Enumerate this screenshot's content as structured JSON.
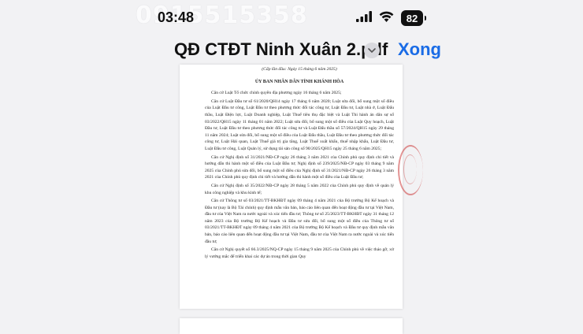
{
  "status_bar": {
    "time": "03:48",
    "battery": "82",
    "watermark": "0915515358"
  },
  "header": {
    "title": "QĐ CTĐT Ninh Xuân 2.pdf",
    "done_label": "Xong"
  },
  "document": {
    "issue_line": "(Cấp lần đầu: Ngày 15 tháng 6 năm 2025)",
    "authority": "ỦY BAN NHÂN DÂN TỈNH KHÁNH HÒA",
    "paragraphs": [
      "Căn cứ Luật Tổ chức chính quyền địa phương ngày 16 tháng 6 năm 2025;",
      "Căn cứ Luật Đầu tư số 61/2020/QH14 ngày 17 tháng 6 năm 2020; Luật sửa đổi, bổ sung một số điều của Luật Đầu tư công, Luật Đầu tư theo phương thức đối tác công tư, Luật Đầu tư, Luật nhà ở, Luật Đấu thầu, Luật Điện lực, Luật Doanh nghiệp, Luật Thuế tiêu thụ đặc biệt và Luật Thi hành án dân sự số 03/2022/QH15 ngày 11 tháng 01 năm 2022; Luật sửa đổi, bổ sung một số điều của Luật Quy hoạch, Luật Đầu tư, Luật Đầu tư theo phương thức đối tác công tư và Luật Đấu thầu số 57/2024/QH15 ngày 29 tháng 11 năm 2024; Luật sửa đổi, bổ sung một số điều của Luật Đấu thầu, Luật Đầu tư theo phương thức đối tác công tư, Luật Hải quan, Luật Thuế giá trị gia tăng, Luật Thuế xuất khẩu, thuế nhập khẩu, Luật Đầu tư, Luật Đầu tư công, Luật Quản lý, sử dụng tài sản công số 90/2025/QH15 ngày 25 tháng 6 năm 2025;",
      "Căn cứ Nghị định số 31/2021/NĐ-CP ngày 26 tháng 3 năm 2021 của Chính phủ quy định chi tiết và hướng dẫn thi hành một số điều của Luật Đầu tư; Nghị định số 239/2025/NĐ-CP ngày 03 tháng 9 năm 2025 của Chính phủ sửa đổi, bổ sung một số điều của Nghị định số 31/2021/NĐ-CP ngày 26 tháng 3 năm 2021 của Chính phủ quy định chi tiết và hướng dẫn thi hành một số điều của Luật Đầu tư;",
      "Căn cứ Nghị định số 35/2022/NĐ-CP ngày 28 tháng 5 năm 2022 của Chính phủ quy định về quản lý khu công nghiệp và khu kinh tế;",
      "Căn cứ Thông tư số 03/2021/TT-BKHĐT ngày 09 tháng 4 năm 2021 của Bộ trưởng Bộ Kế hoạch và Đầu tư (nay là Bộ Tài chính) quy định mẫu văn bản, báo cáo liên quan đến hoạt động đầu tư tại Việt Nam, đầu tư của Việt Nam ra nước ngoài và xúc tiến đầu tư; Thông tư số 25/2023/TT-BKHĐT ngày 31 tháng 12 năm 2023 của Bộ trưởng Bộ Kế hoạch và Đầu tư sửa đổi, bổ sung một số điều của Thông tư số 03/2021/TT-BKHĐT ngày 09 tháng 4 năm 2021 của Bộ trưởng Bộ Kế hoạch và Đầu tư quy định mẫu văn bản, báo cáo liên quan đến hoạt động đầu tư tại Việt Nam, đầu tư của Việt Nam ra nước ngoài và xúc tiến đầu tư;",
      "Căn cứ Nghị quyết số 66.3/2025/NQ-CP ngày 15 tháng 9 năm 2025 của Chính phủ về việc tháo gỡ, xử lý vướng mắc để triển khai các dự án trong thời gian Quy"
    ]
  },
  "colors": {
    "accent": "#1a6ce6",
    "background": "#f2f2f4",
    "seal": "#cd3c3c"
  }
}
